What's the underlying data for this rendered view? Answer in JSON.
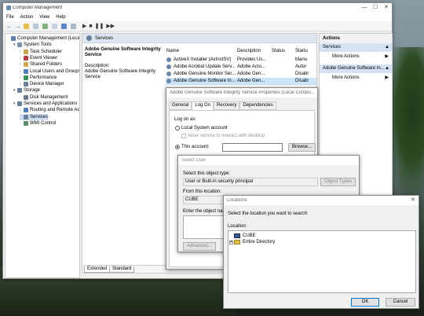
{
  "mmc": {
    "title": "Computer Management",
    "menu": [
      "File",
      "Action",
      "View",
      "Help"
    ],
    "tree": [
      {
        "label": "Computer Management (Local",
        "indent": 0
      },
      {
        "label": "System Tools",
        "indent": 1
      },
      {
        "label": "Task Scheduler",
        "indent": 2
      },
      {
        "label": "Event Viewer",
        "indent": 2
      },
      {
        "label": "Shared Folders",
        "indent": 2
      },
      {
        "label": "Local Users and Groups",
        "indent": 2
      },
      {
        "label": "Performance",
        "indent": 2
      },
      {
        "label": "Device Manager",
        "indent": 2
      },
      {
        "label": "Storage",
        "indent": 1
      },
      {
        "label": "Disk Management",
        "indent": 2
      },
      {
        "label": "Services and Applications",
        "indent": 1
      },
      {
        "label": "Routing and Remote Ac",
        "indent": 2
      },
      {
        "label": "Services",
        "indent": 2
      },
      {
        "label": "WMI Control",
        "indent": 2
      }
    ],
    "services_header": "Services",
    "detail": {
      "name": "Adobe Genuine Software Integrity Service",
      "desc_label": "Description:",
      "desc": "Adobe Genuine Software Integrity Service"
    },
    "columns": [
      "Name",
      "Description",
      "Status",
      "Startu"
    ],
    "rows": [
      {
        "name": "ActiveX Installer (AxInstSV)",
        "desc": "Provides Us...",
        "status": "",
        "startup": "Manu"
      },
      {
        "name": "Adobe Acrobat Update Serv...",
        "desc": "Adobe Acro...",
        "status": "",
        "startup": "Autor"
      },
      {
        "name": "Adobe Genuine Monitor Ser...",
        "desc": "Adobe Gen...",
        "status": "",
        "startup": "Disabl"
      },
      {
        "name": "Adobe Genuine Software In...",
        "desc": "Adobe Gen...",
        "status": "",
        "startup": "Disabl"
      }
    ],
    "tabs": [
      "Extended",
      "Standard"
    ],
    "actions": {
      "header": "Actions",
      "section1": "Services",
      "more1": "More Actions",
      "section2": "Adobe Genuine Software In...",
      "more2": "More Actions"
    }
  },
  "props": {
    "title": "Adobe Genuine Software Integrity Service Properties (Local Compu...",
    "tabs": [
      "General",
      "Log On",
      "Recovery",
      "Dependencies"
    ],
    "logon_as": "Log on as:",
    "local_system": "Local System account",
    "allow_interact": "Allow service to interact with desktop",
    "this_account": "This account:",
    "browse": "Browse..."
  },
  "select_user": {
    "title": "Select User",
    "object_type_label": "Select this object type:",
    "object_type_value": "User or Built-in security principal",
    "object_types_btn": "Object Types",
    "location_label": "From this location:",
    "location_value": "CUBE",
    "enter_label": "Enter the object name",
    "advanced_btn": "Advanced..."
  },
  "locations": {
    "title": "Locations",
    "instruction": "Select the location you want to search:",
    "location_label": "Location:",
    "items": [
      "CUBE",
      "Entire Directory"
    ],
    "ok": "OK",
    "cancel": "Cancel",
    "close": "✕"
  }
}
